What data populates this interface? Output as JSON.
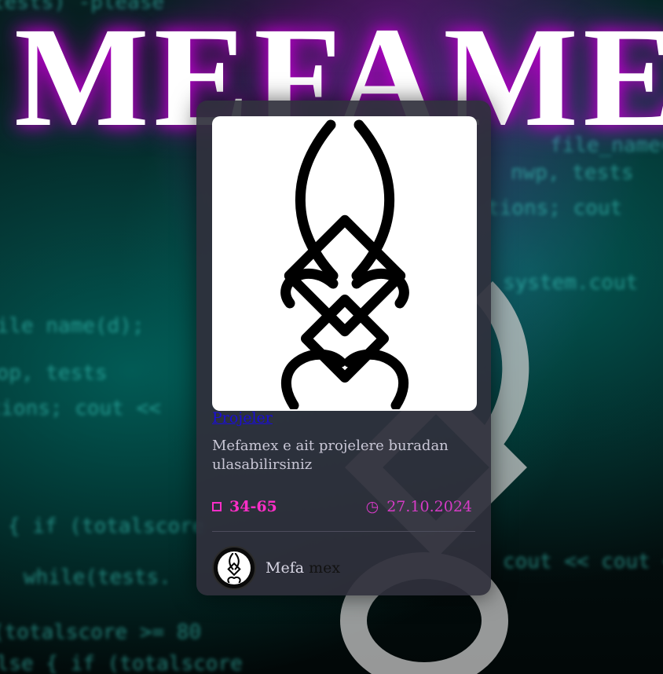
{
  "background": {
    "title": "MEFAME",
    "code_lines": [
      "tests) -please",
      "file_name=\"d\"",
      "nwp, tests",
      "tions; cout",
      "file name(d);",
      "hop, tests",
      "ctions; cout <<",
      "system.cout",
      "{ if (totalscore",
      "while(tests.",
      "cout << cout <<",
      "(totalscore >= 80",
      "else { if (totalscore"
    ]
  },
  "card": {
    "link_label": "Projeler",
    "description": "Mefamex e ait projelere buradan ulasabilirsiniz",
    "views": "34-65",
    "date": "27.10.2024",
    "author_first": "Mefa",
    "author_second": "mex"
  },
  "colors": {
    "accent_pink": "#ff2ec8",
    "link_blue": "#1a0dd6",
    "card_bg": "#30303c"
  },
  "icons": {
    "views": "square-icon",
    "date": "clock-icon"
  }
}
